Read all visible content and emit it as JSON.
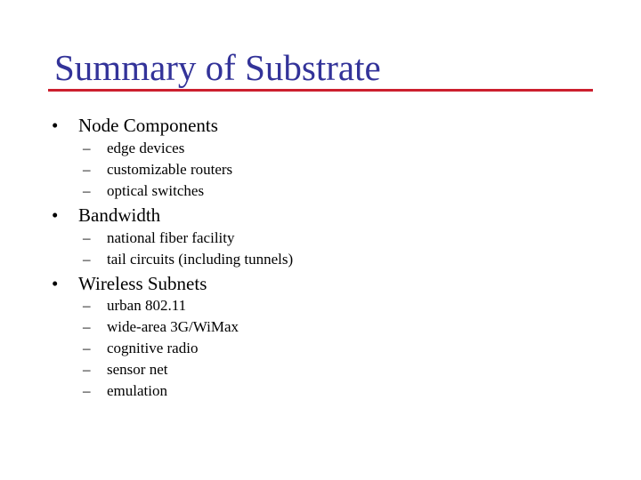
{
  "slide": {
    "title": "Summary of Substrate",
    "bullet_glyph": "•",
    "dash_glyph": "–",
    "colors": {
      "title": "#333399",
      "rule": "#cc1f2e"
    },
    "sections": [
      {
        "heading": "Node Components",
        "items": [
          "edge devices",
          "customizable routers",
          "optical switches"
        ]
      },
      {
        "heading": "Bandwidth",
        "items": [
          "national fiber facility",
          "tail circuits (including tunnels)"
        ]
      },
      {
        "heading": "Wireless Subnets",
        "items": [
          "urban 802.11",
          "wide-area 3G/WiMax",
          "cognitive radio",
          "sensor net",
          "emulation"
        ]
      }
    ]
  }
}
